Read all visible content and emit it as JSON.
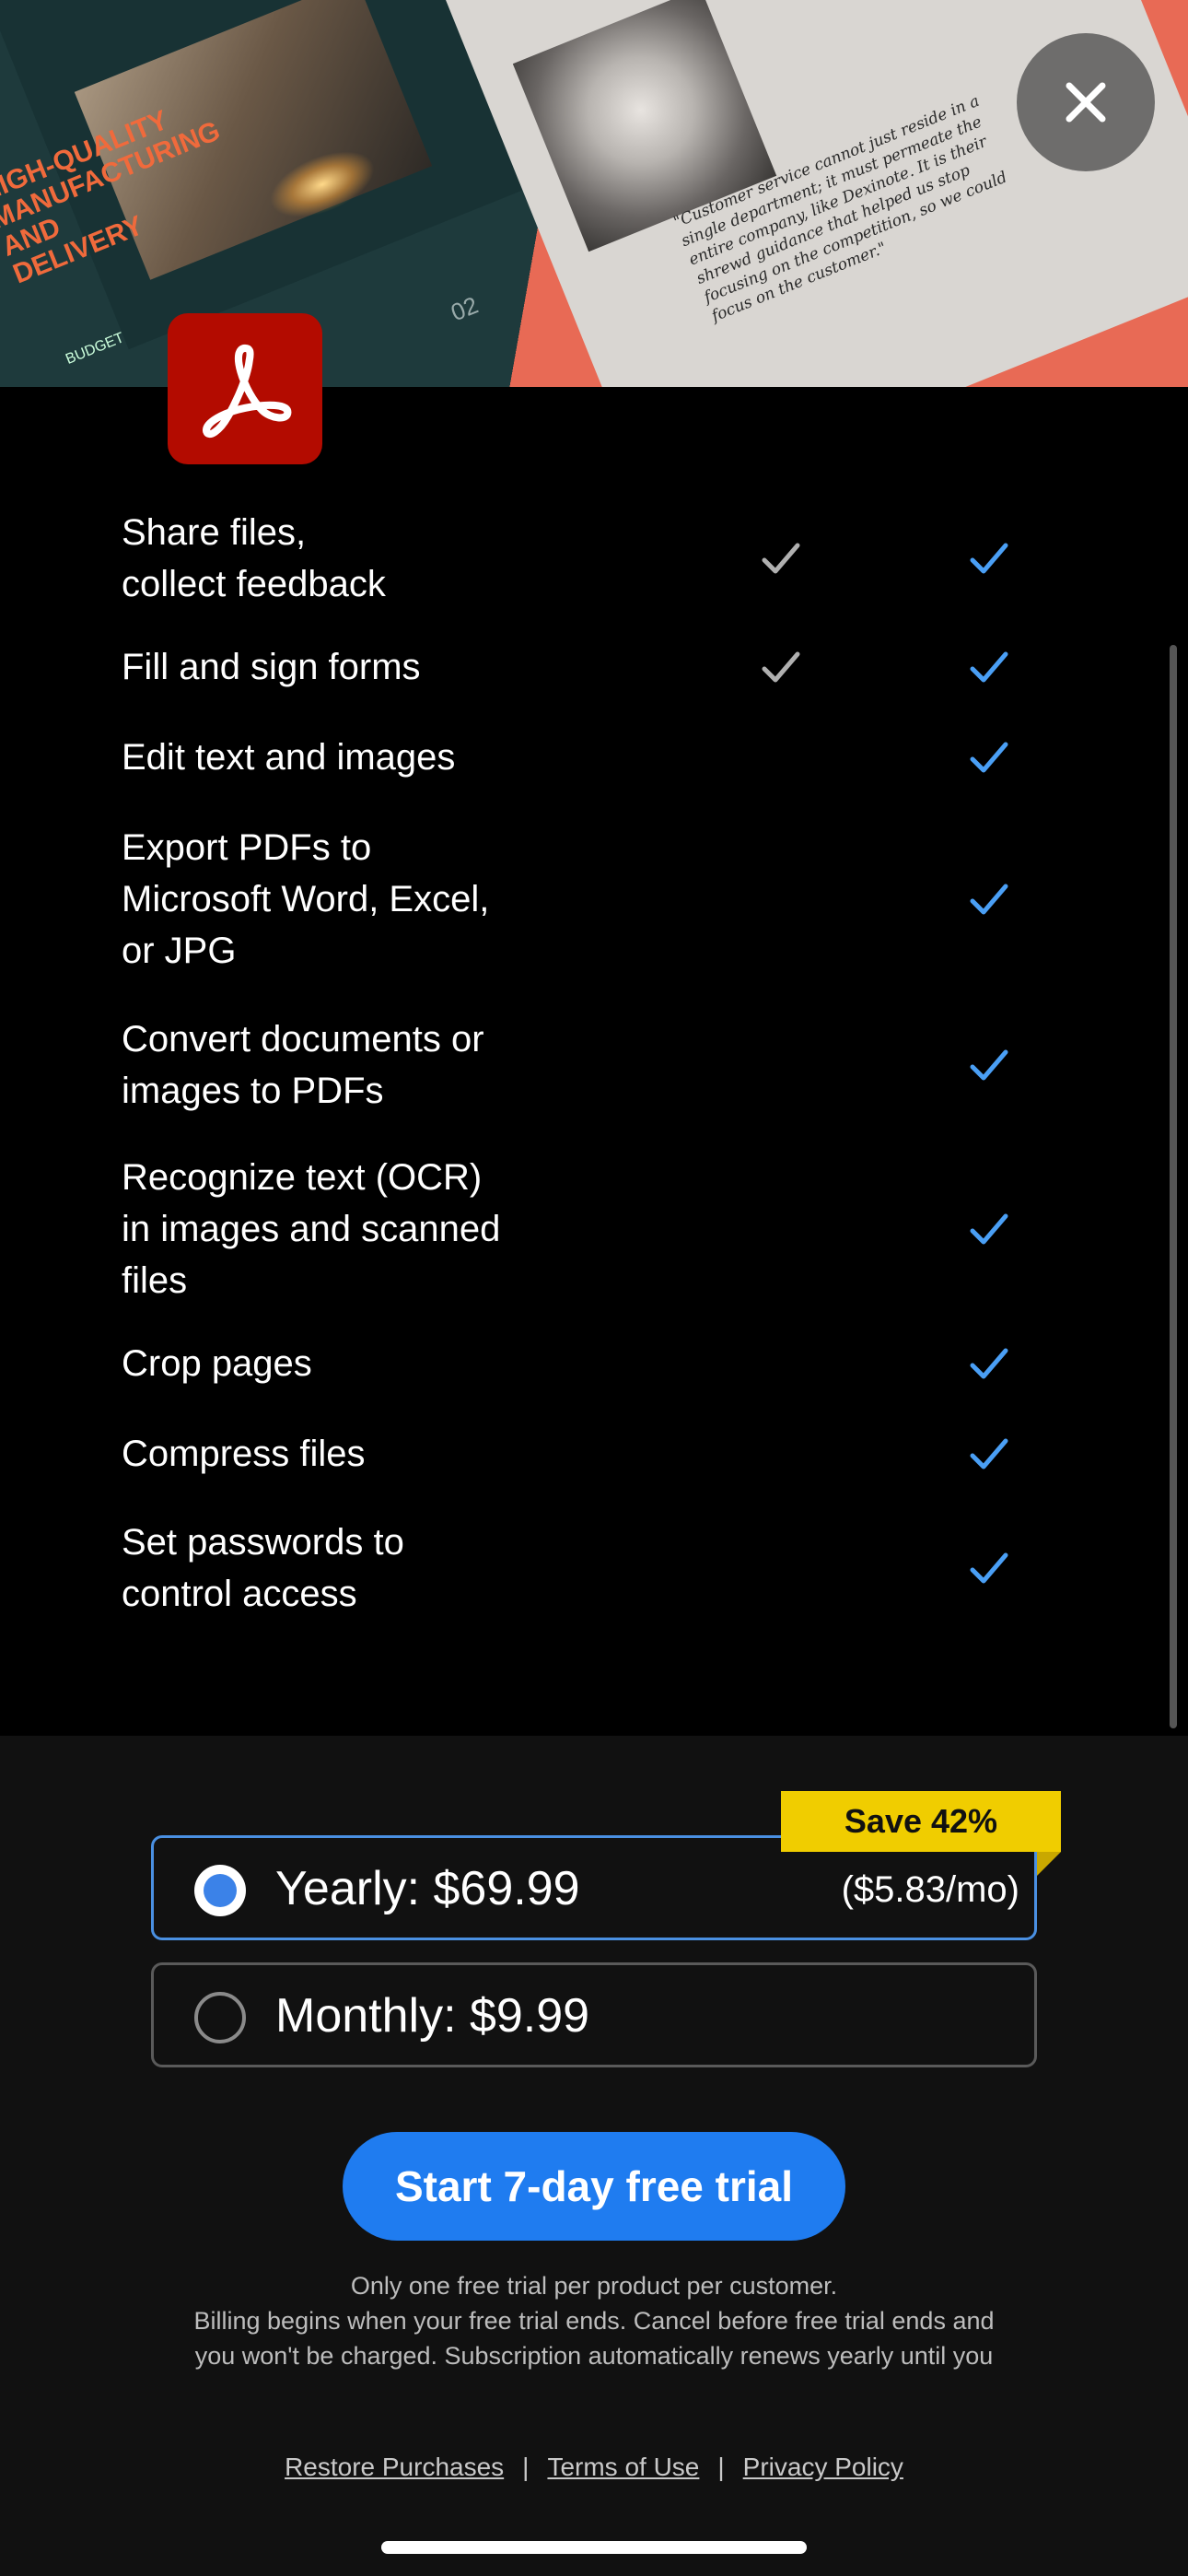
{
  "hero": {
    "headline": "HIGH-QUALITY MANUFACTURING AND DELIVERY",
    "quote": "\"Customer service cannot just reside in a single department; it must permeate the entire company, like Dexinote. It is their shrewd guidance that helped us stop focusing on the competition, so we could focus on the customer.\"",
    "page_number": "02",
    "section_label": "BUDGET",
    "close_icon": "close-icon"
  },
  "app": {
    "logo_icon": "acrobat-logo-icon",
    "brand_color": "#b30b00"
  },
  "features": {
    "rows": [
      {
        "label": "Share files,\ncollect feedback",
        "free": true,
        "pro": true
      },
      {
        "label": "Fill and sign forms",
        "free": true,
        "pro": true
      },
      {
        "label": "Edit text and images",
        "free": false,
        "pro": true
      },
      {
        "label": "Export PDFs to\nMicrosoft Word, Excel,\nor JPG",
        "free": false,
        "pro": true
      },
      {
        "label": "Convert documents or\nimages to PDFs",
        "free": false,
        "pro": true
      },
      {
        "label": "Recognize text (OCR)\nin images and scanned\nfiles",
        "free": false,
        "pro": true
      },
      {
        "label": "Crop pages",
        "free": false,
        "pro": true
      },
      {
        "label": "Compress files",
        "free": false,
        "pro": true
      },
      {
        "label": "Set passwords to\ncontrol access",
        "free": false,
        "pro": true
      }
    ],
    "free_check_color": "#b0b0b0",
    "pro_check_color": "#4a9ff5"
  },
  "plans": {
    "save_badge": "Save 42%",
    "yearly": {
      "label": "Yearly: $69.99",
      "per_month": "($5.83/mo)",
      "selected": true
    },
    "monthly": {
      "label": "Monthly: $9.99",
      "selected": false
    }
  },
  "cta": {
    "label": "Start 7-day free trial"
  },
  "disclaimer": {
    "line1": "Only one free trial per product per customer.",
    "line2": "Billing begins when your free trial ends. Cancel before free trial ends and",
    "line3": "you won't be charged. Subscription automatically renews yearly until you"
  },
  "links": {
    "restore": "Restore Purchases",
    "terms": "Terms of Use",
    "privacy": "Privacy Policy",
    "separator": "|"
  },
  "colors": {
    "accent": "#1f7cf0",
    "badge": "#f0cd00",
    "selected_border": "#4a90e2"
  }
}
